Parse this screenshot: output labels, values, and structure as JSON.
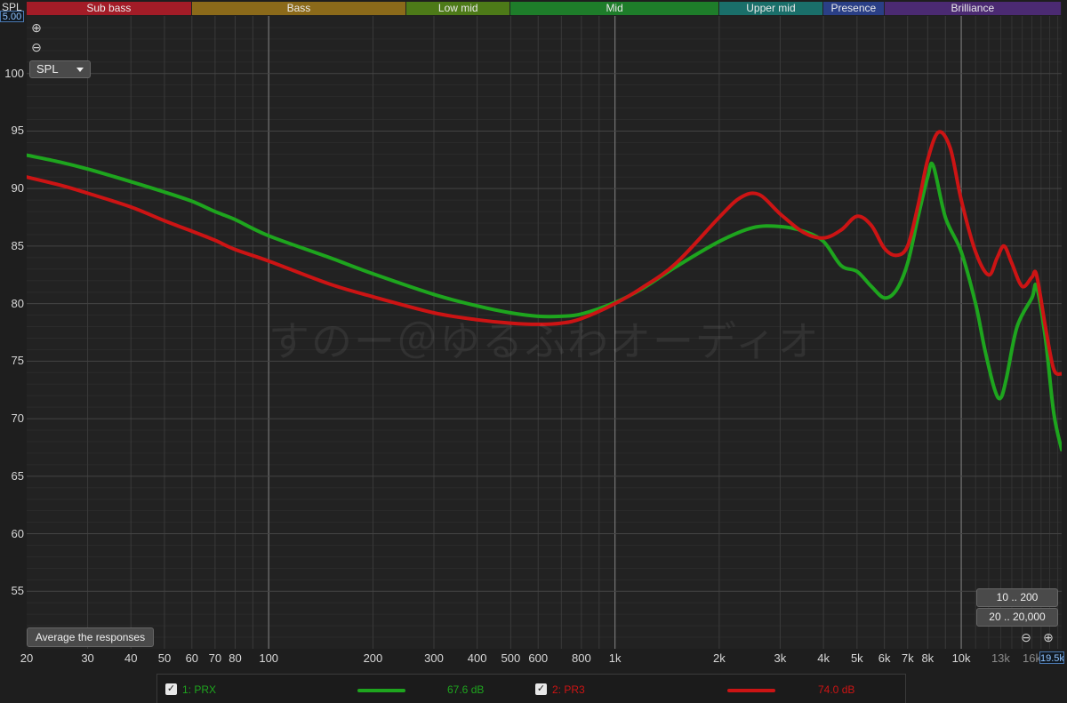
{
  "header": {
    "spl_label": "SPL",
    "top_readout": "5.00"
  },
  "bands": [
    {
      "label": "Sub bass",
      "color": "#a31c27"
    },
    {
      "label": "Bass",
      "color": "#8b6a1a"
    },
    {
      "label": "Low mid",
      "color": "#4d7a18"
    },
    {
      "label": "Mid",
      "color": "#1e7d2a"
    },
    {
      "label": "Upper mid",
      "color": "#1a6f6a"
    },
    {
      "label": "Presence",
      "color": "#2a3f86"
    },
    {
      "label": "Brilliance",
      "color": "#4b2a72"
    }
  ],
  "controls": {
    "zoom_in_icon": "zoom-in-icon",
    "zoom_out_icon": "zoom-out-icon",
    "spl_select": "SPL",
    "average_button": "Average the responses",
    "range_button_1": "10 .. 200",
    "range_button_2": "20 .. 20,000",
    "bottom_readout": "19.5k"
  },
  "watermark": "すのー＠ゆるふわオーディオ",
  "legend": [
    {
      "label": "1: PRX",
      "value": "67.6 dB",
      "color": "#1ea51e"
    },
    {
      "label": "2: PR3",
      "value": "74.0 dB",
      "color": "#cc1414"
    }
  ],
  "chart_data": {
    "type": "line",
    "ylabel": "SPL",
    "xscale": "log",
    "xlim": [
      20,
      19500
    ],
    "ylim": [
      50,
      105
    ],
    "y_ticks": [
      55,
      60,
      65,
      70,
      75,
      80,
      85,
      90,
      95,
      100
    ],
    "x_ticks": [
      {
        "v": 20,
        "label": "20"
      },
      {
        "v": 30,
        "label": "30"
      },
      {
        "v": 40,
        "label": "40"
      },
      {
        "v": 50,
        "label": "50"
      },
      {
        "v": 60,
        "label": "60"
      },
      {
        "v": 70,
        "label": "70"
      },
      {
        "v": 80,
        "label": "80"
      },
      {
        "v": 100,
        "label": "100"
      },
      {
        "v": 200,
        "label": "200"
      },
      {
        "v": 300,
        "label": "300"
      },
      {
        "v": 400,
        "label": "400"
      },
      {
        "v": 500,
        "label": "500"
      },
      {
        "v": 600,
        "label": "600"
      },
      {
        "v": 800,
        "label": "800"
      },
      {
        "v": 1000,
        "label": "1k"
      },
      {
        "v": 2000,
        "label": "2k"
      },
      {
        "v": 3000,
        "label": "3k"
      },
      {
        "v": 4000,
        "label": "4k"
      },
      {
        "v": 5000,
        "label": "5k"
      },
      {
        "v": 6000,
        "label": "6k"
      },
      {
        "v": 7000,
        "label": "7k"
      },
      {
        "v": 8000,
        "label": "8k"
      },
      {
        "v": 10000,
        "label": "10k"
      },
      {
        "v": 13000,
        "label": "13k",
        "dim": true
      },
      {
        "v": 16000,
        "label": "16k",
        "dim": true
      }
    ],
    "bands_hz": [
      20,
      60,
      250,
      500,
      2000,
      4000,
      6000,
      19500
    ],
    "grid": true,
    "series": [
      {
        "name": "1: PRX",
        "color": "#1ea51e",
        "points": [
          [
            20,
            92.9
          ],
          [
            25,
            92.3
          ],
          [
            30,
            91.7
          ],
          [
            40,
            90.6
          ],
          [
            50,
            89.7
          ],
          [
            60,
            88.9
          ],
          [
            70,
            88.0
          ],
          [
            80,
            87.3
          ],
          [
            100,
            85.9
          ],
          [
            150,
            84.0
          ],
          [
            200,
            82.6
          ],
          [
            300,
            80.8
          ],
          [
            400,
            79.8
          ],
          [
            500,
            79.2
          ],
          [
            600,
            78.9
          ],
          [
            700,
            78.9
          ],
          [
            800,
            79.1
          ],
          [
            1000,
            80.1
          ],
          [
            1200,
            81.3
          ],
          [
            1500,
            83.2
          ],
          [
            2000,
            85.4
          ],
          [
            2500,
            86.6
          ],
          [
            3000,
            86.7
          ],
          [
            3500,
            86.3
          ],
          [
            4000,
            85.4
          ],
          [
            4500,
            83.3
          ],
          [
            5000,
            82.8
          ],
          [
            5500,
            81.5
          ],
          [
            6000,
            80.5
          ],
          [
            6500,
            81.2
          ],
          [
            7000,
            83.5
          ],
          [
            7500,
            87.5
          ],
          [
            8000,
            91.0
          ],
          [
            8300,
            92.0
          ],
          [
            9000,
            87.5
          ],
          [
            10000,
            84.5
          ],
          [
            11000,
            80.0
          ],
          [
            11700,
            76.0
          ],
          [
            12500,
            72.5
          ],
          [
            13000,
            71.8
          ],
          [
            13500,
            73.5
          ],
          [
            14500,
            78.0
          ],
          [
            16000,
            80.5
          ],
          [
            16500,
            81.5
          ],
          [
            17500,
            77.0
          ],
          [
            18500,
            70.5
          ],
          [
            19500,
            67.3
          ]
        ]
      },
      {
        "name": "2: PR3",
        "color": "#cc1414",
        "points": [
          [
            20,
            91.0
          ],
          [
            25,
            90.3
          ],
          [
            30,
            89.6
          ],
          [
            40,
            88.4
          ],
          [
            50,
            87.2
          ],
          [
            60,
            86.3
          ],
          [
            70,
            85.5
          ],
          [
            80,
            84.7
          ],
          [
            100,
            83.7
          ],
          [
            150,
            81.7
          ],
          [
            200,
            80.6
          ],
          [
            300,
            79.2
          ],
          [
            400,
            78.6
          ],
          [
            500,
            78.3
          ],
          [
            600,
            78.2
          ],
          [
            700,
            78.3
          ],
          [
            800,
            78.7
          ],
          [
            1000,
            80.0
          ],
          [
            1200,
            81.4
          ],
          [
            1500,
            83.5
          ],
          [
            2000,
            87.5
          ],
          [
            2300,
            89.2
          ],
          [
            2600,
            89.5
          ],
          [
            3000,
            87.8
          ],
          [
            3500,
            86.2
          ],
          [
            4000,
            85.7
          ],
          [
            4500,
            86.4
          ],
          [
            5000,
            87.6
          ],
          [
            5500,
            86.8
          ],
          [
            6000,
            84.8
          ],
          [
            6500,
            84.2
          ],
          [
            7000,
            85.0
          ],
          [
            7500,
            88.5
          ],
          [
            8000,
            92.5
          ],
          [
            8600,
            94.9
          ],
          [
            9300,
            93.5
          ],
          [
            10000,
            89.0
          ],
          [
            11000,
            84.5
          ],
          [
            12000,
            82.5
          ],
          [
            12700,
            84.0
          ],
          [
            13300,
            85.0
          ],
          [
            14000,
            83.5
          ],
          [
            15000,
            81.5
          ],
          [
            16000,
            82.3
          ],
          [
            16500,
            82.5
          ],
          [
            17500,
            78.0
          ],
          [
            18500,
            74.3
          ],
          [
            19500,
            73.9
          ]
        ]
      }
    ]
  }
}
